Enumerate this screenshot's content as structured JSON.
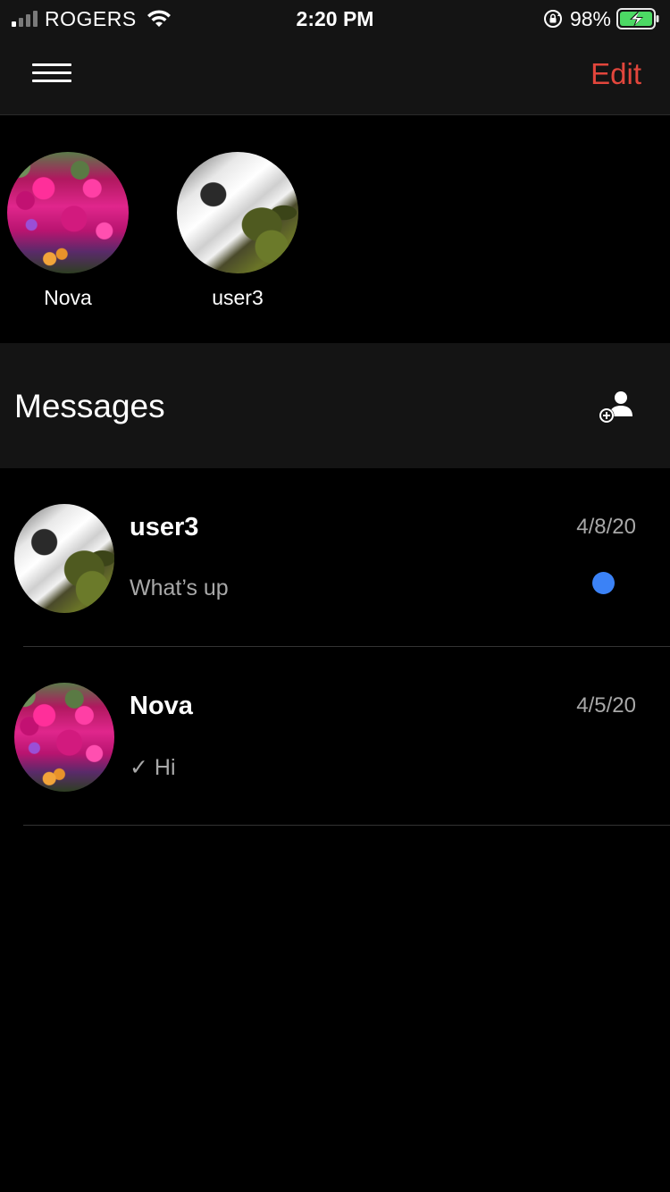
{
  "status_bar": {
    "carrier": "ROGERS",
    "time": "2:20 PM",
    "battery_percent": "98%",
    "battery_level": 0.98
  },
  "nav": {
    "menu_icon": "hamburger-menu-icon",
    "edit_label": "Edit",
    "accent_color": "#e2463c"
  },
  "stories": [
    {
      "name": "Nova",
      "avatar": "flowers"
    },
    {
      "name": "user3",
      "avatar": "waterfall"
    }
  ],
  "messages_header": {
    "title": "Messages",
    "add_icon": "add-contact-icon"
  },
  "conversations": [
    {
      "name": "user3",
      "preview": "What’s up",
      "date": "4/8/20",
      "unread": true,
      "avatar": "waterfall"
    },
    {
      "name": "Nova",
      "preview": "✓ Hi",
      "date": "4/5/20",
      "unread": false,
      "avatar": "flowers"
    }
  ],
  "colors": {
    "unread_dot": "#3b82f6",
    "bar_background": "#141414"
  }
}
